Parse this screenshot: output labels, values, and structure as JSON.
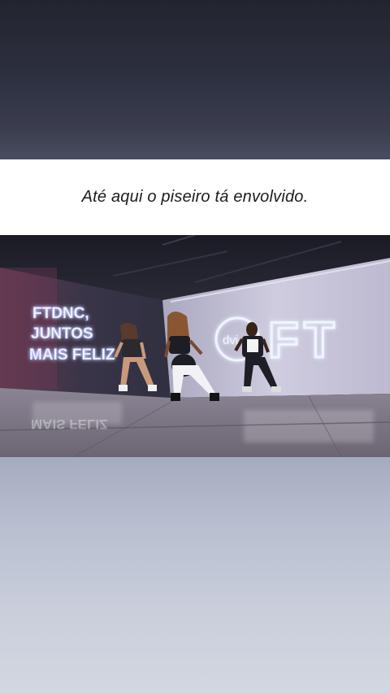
{
  "caption": {
    "text": "Até aqui o piseiro tá envolvido."
  },
  "video": {
    "neon_sign_left": [
      "FTDNC,",
      "JUNTOS",
      "MAIS FELIZ"
    ],
    "neon_sign_right_logo": "FT",
    "small_logo": "dvi",
    "colors": {
      "neon_left": "#f3f4ff",
      "neon_glow_left": "#a9b8ff",
      "neon_right": "#eef5ff",
      "neon_glow_right": "#8fb8ff",
      "wall_left": "#3b3446",
      "wall_right": "#c6c3d8",
      "floor": "#7b7684"
    }
  }
}
